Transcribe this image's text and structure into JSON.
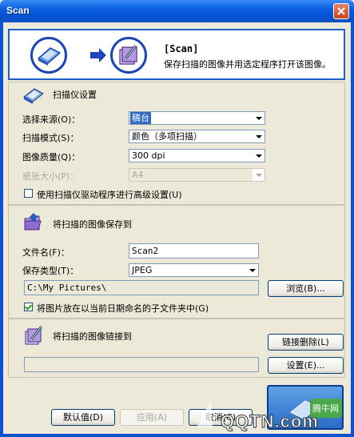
{
  "window": {
    "title": "Scan"
  },
  "banner": {
    "title": "[Scan]",
    "description": "保存扫描的图像并用选定程序打开该图像。"
  },
  "scanner_settings": {
    "title": "扫描仪设置",
    "source_label": "选择来源(O)：",
    "source_value": "稿台",
    "mode_label": "扫描模式(S)：",
    "mode_value": "颜色（多项扫描）",
    "quality_label": "图像质量(Q)：",
    "quality_value": "300 dpi",
    "paper_label": "纸张大小(P)：",
    "paper_value": "A4",
    "advanced_label": "使用扫描仪驱动程序进行高级设置(U)",
    "advanced_checked": false
  },
  "save_settings": {
    "title": "将扫描的图像保存到",
    "filename_label": "文件名(F)：",
    "filename_value": "Scan2",
    "type_label": "保存类型(T)：",
    "type_value": "JPEG",
    "path_value": "C:\\My Pictures\\",
    "browse_label": "浏览(B)...",
    "subfolder_label": "将图片放在以当前日期命名的子文件夹中(G)",
    "subfolder_checked": true
  },
  "link_settings": {
    "title": "将扫描的图像链接到",
    "remove_link_label": "链接删除(L)",
    "settings_label": "设置(E)..."
  },
  "footer": {
    "default_label": "默认值(D)",
    "apply_label": "应用(A)",
    "cancel_label": "取消(C)"
  },
  "watermark": {
    "site": "QQTN.com",
    "badge": "腾牛网"
  }
}
